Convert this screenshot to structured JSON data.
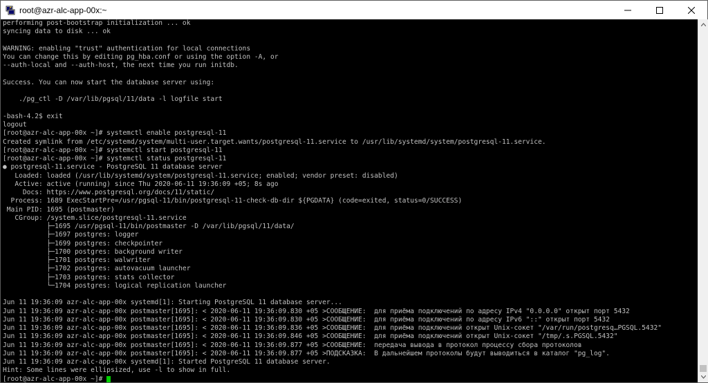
{
  "window": {
    "title": "root@azr-alc-app-00x:~",
    "icon": "putty-terminal-icon",
    "controls": {
      "minimize": "minimize-icon",
      "maximize": "maximize-icon",
      "close": "close-icon"
    }
  },
  "terminal": {
    "lines": [
      "performing post-bootstrap initialization ... ok",
      "syncing data to disk ... ok",
      "",
      "WARNING: enabling \"trust\" authentication for local connections",
      "You can change this by editing pg_hba.conf or using the option -A, or",
      "--auth-local and --auth-host, the next time you run initdb.",
      "",
      "Success. You can now start the database server using:",
      "",
      "    ./pg_ctl -D /var/lib/pgsql/11/data -l logfile start",
      "",
      "-bash-4.2$ exit",
      "logout",
      "[root@azr-alc-app-00x ~]# systemctl enable postgresql-11",
      "Created symlink from /etc/systemd/system/multi-user.target.wants/postgresql-11.service to /usr/lib/systemd/system/postgresql-11.service.",
      "[root@azr-alc-app-00x ~]# systemctl start postgresql-11",
      "[root@azr-alc-app-00x ~]# systemctl status postgresql-11",
      "● postgresql-11.service - PostgreSQL 11 database server",
      "   Loaded: loaded (/usr/lib/systemd/system/postgresql-11.service; enabled; vendor preset: disabled)",
      "   Active: active (running) since Thu 2020-06-11 19:36:09 +05; 8s ago",
      "     Docs: https://www.postgresql.org/docs/11/static/",
      "  Process: 1689 ExecStartPre=/usr/pgsql-11/bin/postgresql-11-check-db-dir ${PGDATA} (code=exited, status=0/SUCCESS)",
      " Main PID: 1695 (postmaster)",
      "   CGroup: /system.slice/postgresql-11.service",
      "           ├─1695 /usr/pgsql-11/bin/postmaster -D /var/lib/pgsql/11/data/",
      "           ├─1697 postgres: logger",
      "           ├─1699 postgres: checkpointer",
      "           ├─1700 postgres: background writer",
      "           ├─1701 postgres: walwriter",
      "           ├─1702 postgres: autovacuum launcher",
      "           ├─1703 postgres: stats collector",
      "           └─1704 postgres: logical replication launcher",
      "",
      "Jun 11 19:36:09 azr-alc-app-00x systemd[1]: Starting PostgreSQL 11 database server...",
      "Jun 11 19:36:09 azr-alc-app-00x postmaster[1695]: < 2020-06-11 19:36:09.830 +05 >СООБЩЕНИЕ:  для приёма подключений по адресу IPv4 \"0.0.0.0\" открыт порт 5432",
      "Jun 11 19:36:09 azr-alc-app-00x postmaster[1695]: < 2020-06-11 19:36:09.830 +05 >СООБЩЕНИЕ:  для приёма подключений по адресу IPv6 \"::\" открыт порт 5432",
      "Jun 11 19:36:09 azr-alc-app-00x postmaster[1695]: < 2020-06-11 19:36:09.836 +05 >СООБЩЕНИЕ:  для приёма подключений открыт Unix-сокет \"/var/run/postgresq…PGSQL.5432\"",
      "Jun 11 19:36:09 azr-alc-app-00x postmaster[1695]: < 2020-06-11 19:36:09.846 +05 >СООБЩЕНИЕ:  для приёма подключений открыт Unix-сокет \"/tmp/.s.PGSQL.5432\"",
      "Jun 11 19:36:09 azr-alc-app-00x postmaster[1695]: < 2020-06-11 19:36:09.877 +05 >СООБЩЕНИЕ:  передача вывода в протокол процессу сбора протоколов",
      "Jun 11 19:36:09 azr-alc-app-00x postmaster[1695]: < 2020-06-11 19:36:09.877 +05 >ПОДСКАЗКА:  В дальнейшем протоколы будут выводиться в каталог \"pg_log\".",
      "Jun 11 19:36:09 azr-alc-app-00x systemd[1]: Started PostgreSQL 11 database server.",
      "Hint: Some lines were ellipsized, use -l to show in full."
    ],
    "prompt": "[root@azr-alc-app-00x ~]# ",
    "cursor_color": "#00d000",
    "foreground_color": "#c0c0c0",
    "background_color": "#000000"
  },
  "scrollbar": {
    "up_icon": "scroll-up-icon",
    "down_icon": "scroll-down-icon"
  }
}
